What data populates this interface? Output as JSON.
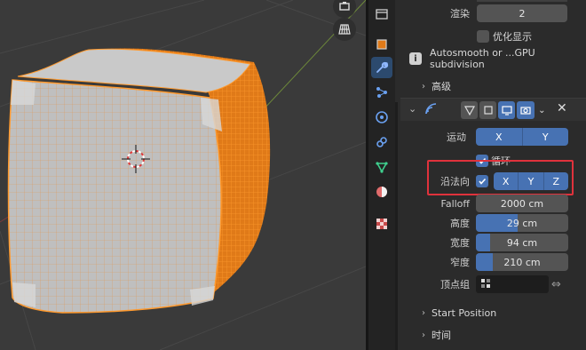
{
  "viewport": {
    "icons": [
      "toolbox-icon",
      "grid-icon"
    ]
  },
  "tools": [
    "object-icon",
    "wrench-icon",
    "particles-icon",
    "physics-icon",
    "constraints-icon",
    "object-data-icon",
    "material-icon",
    "texture-icon"
  ],
  "top": {
    "render_label": "渲染",
    "render_value": "2",
    "optimal_display_label": "优化显示",
    "info_text": "Autosmooth or ...GPU subdivision",
    "advanced_label": "高级"
  },
  "modifier": {
    "motion_label": "运动",
    "motion_axes": [
      "X",
      "Y"
    ],
    "loop_label": "循环",
    "normal_label": "沿法向",
    "normal_axes": [
      "X",
      "Y",
      "Z"
    ],
    "falloff_label": "Falloff",
    "falloff_value": "2000 cm",
    "height_label": "高度",
    "height_value": "29 cm",
    "height_fill": 0.45,
    "width_label": "宽度",
    "width_value": "94 cm",
    "width_fill": 0.15,
    "narrowness_label": "窄度",
    "narrowness_value": "210 cm",
    "narrowness_fill": 0.18,
    "vertex_group_label": "顶点组",
    "start_position_label": "Start Position",
    "time_label": "时间"
  },
  "colors": {
    "accent": "#4772b3",
    "highlight": "#e0323c",
    "wire": "#ff9a2e"
  }
}
